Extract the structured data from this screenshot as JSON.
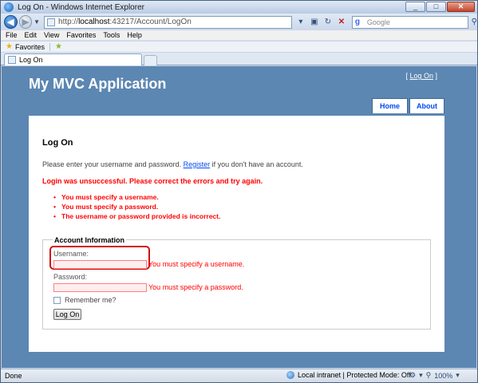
{
  "window": {
    "title": "Log On - Windows Internet Explorer",
    "min": "_",
    "max": "□",
    "close": "✕"
  },
  "address": {
    "url_prefix": "http://",
    "url_host": "localhost",
    "url_rest": ":43217/Account/LogOn",
    "search_placeholder": "Google"
  },
  "menubar": [
    "File",
    "Edit",
    "View",
    "Favorites",
    "Tools",
    "Help"
  ],
  "favorites": {
    "label": "Favorites"
  },
  "tab": {
    "label": "Log On"
  },
  "site": {
    "title": "My MVC Application",
    "login_prefix": "[ ",
    "login_link": "Log On",
    "login_suffix": " ]",
    "menu": [
      "Home",
      "About"
    ]
  },
  "page": {
    "heading": "Log On",
    "intro_before": "Please enter your username and password. ",
    "intro_link": "Register",
    "intro_after": " if you don't have an account.",
    "summary": "Login was unsuccessful. Please correct the errors and try again.",
    "errors": [
      "You must specify a username.",
      "You must specify a password.",
      "The username or password provided is incorrect."
    ],
    "legend": "Account Information",
    "username_label": "Username:",
    "username_value": "",
    "username_error": "You must specify a username.",
    "password_label": "Password:",
    "password_value": "",
    "password_error": "You must specify a password.",
    "remember_label": "Remember me?",
    "submit_label": "Log On"
  },
  "status": {
    "text": "Done",
    "zone": "Local intranet | Protected Mode: Off",
    "zoom": "100%"
  }
}
